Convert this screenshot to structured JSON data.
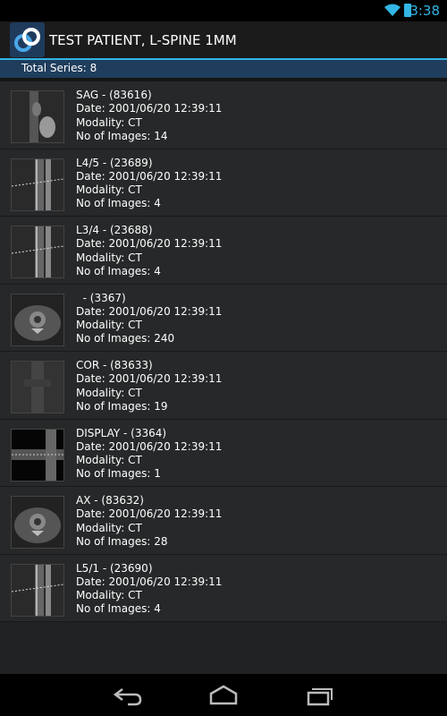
{
  "status_bar": {
    "time": "3:38",
    "icons": [
      "wifi-icon",
      "battery-icon"
    ]
  },
  "action_bar": {
    "title": "TEST PATIENT, L-SPINE 1MM",
    "app_icon": "app-logo-icon"
  },
  "subheader": {
    "text": "Total Series: 8"
  },
  "series": [
    {
      "name": "SAG - (83616)",
      "date": "Date: 2001/06/20 12:39:11",
      "modality": "Modality: CT",
      "images": "No of Images: 14",
      "thumb": "sagittal"
    },
    {
      "name": "L4/5 - (23689)",
      "date": "Date: 2001/06/20 12:39:11",
      "modality": "Modality: CT",
      "images": "No of Images: 4",
      "thumb": "sagittal-lines"
    },
    {
      "name": "L3/4 - (23688)",
      "date": "Date: 2001/06/20 12:39:11",
      "modality": "Modality: CT",
      "images": "No of Images: 4",
      "thumb": "sagittal-lines"
    },
    {
      "name": "  - (3367)",
      "date": "Date: 2001/06/20 12:39:11",
      "modality": "Modality: CT",
      "images": "No of Images: 240",
      "thumb": "axial"
    },
    {
      "name": "COR - (83633)",
      "date": "Date: 2001/06/20 12:39:11",
      "modality": "Modality: CT",
      "images": "No of Images: 19",
      "thumb": "coronal"
    },
    {
      "name": "DISPLAY - (3364)",
      "date": "Date: 2001/06/20 12:39:11",
      "modality": "Modality: CT",
      "images": "No of Images: 1",
      "thumb": "display"
    },
    {
      "name": "AX - (83632)",
      "date": "Date: 2001/06/20 12:39:11",
      "modality": "Modality: CT",
      "images": "No of Images: 28",
      "thumb": "axial"
    },
    {
      "name": "L5/1 - (23690)",
      "date": "Date: 2001/06/20 12:39:11",
      "modality": "Modality: CT",
      "images": "No of Images: 4",
      "thumb": "sagittal-lines"
    }
  ],
  "nav_bar": {
    "buttons": [
      "back-icon",
      "home-icon",
      "recent-apps-icon"
    ]
  },
  "colors": {
    "accent": "#33b5e5",
    "header_bg": "#1f3d5c",
    "list_bg": "#262829"
  }
}
